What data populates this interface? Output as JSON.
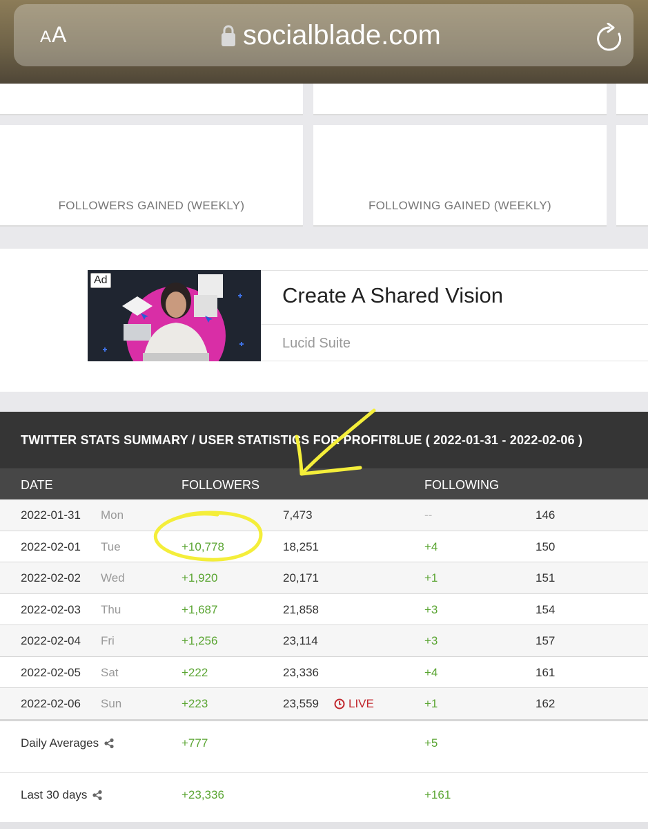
{
  "browser": {
    "text_size_small": "A",
    "text_size_large": "A",
    "url": "socialblade.com"
  },
  "charts": {
    "followers_weekly": "FOLLOWERS GAINED (WEEKLY)",
    "following_weekly": "FOLLOWING GAINED (WEEKLY)"
  },
  "ad": {
    "badge": "Ad",
    "headline": "Create A Shared Vision",
    "sponsor": "Lucid Suite"
  },
  "stats": {
    "title": "TWITTER STATS SUMMARY / USER STATISTICS FOR PROFIT8LUE ( 2022-01-31 - 2022-02-06 )",
    "columns": {
      "date": "DATE",
      "followers": "FOLLOWERS",
      "following": "FOLLOWING"
    },
    "rows": [
      {
        "date": "2022-01-31",
        "day": "Mon",
        "followers_change": "",
        "followers_total": "7,473",
        "following_change": "--",
        "following_total": "146"
      },
      {
        "date": "2022-02-01",
        "day": "Tue",
        "followers_change": "+10,778",
        "followers_total": "18,251",
        "following_change": "+4",
        "following_total": "150"
      },
      {
        "date": "2022-02-02",
        "day": "Wed",
        "followers_change": "+1,920",
        "followers_total": "20,171",
        "following_change": "+1",
        "following_total": "151"
      },
      {
        "date": "2022-02-03",
        "day": "Thu",
        "followers_change": "+1,687",
        "followers_total": "21,858",
        "following_change": "+3",
        "following_total": "154"
      },
      {
        "date": "2022-02-04",
        "day": "Fri",
        "followers_change": "+1,256",
        "followers_total": "23,114",
        "following_change": "+3",
        "following_total": "157"
      },
      {
        "date": "2022-02-05",
        "day": "Sat",
        "followers_change": "+222",
        "followers_total": "23,336",
        "following_change": "+4",
        "following_total": "161"
      },
      {
        "date": "2022-02-06",
        "day": "Sun",
        "followers_change": "+223",
        "followers_total": "23,559",
        "following_change": "+1",
        "following_total": "162"
      }
    ],
    "live_label": "LIVE",
    "summary": {
      "daily_label": "Daily Averages",
      "daily_followers": "+777",
      "daily_following": "+5",
      "thirty_label": "Last 30 days",
      "thirty_followers": "+23,336",
      "thirty_following": "+161"
    }
  },
  "colors": {
    "positive": "#5aa532",
    "live": "#c1272d",
    "header_dark": "#353535",
    "header_mid": "#474747",
    "marker": "#f4ee3a"
  }
}
